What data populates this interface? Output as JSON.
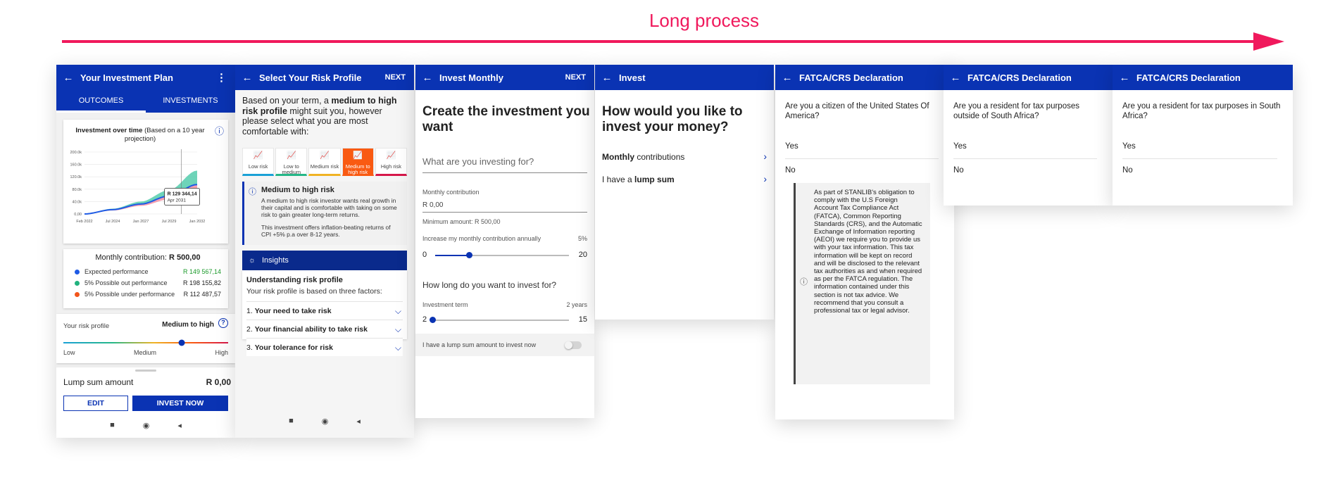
{
  "process": {
    "label": "Long process"
  },
  "screen1": {
    "title": "Your Investment Plan",
    "tabs": [
      "OUTCOMES",
      "INVESTMENTS"
    ],
    "chart_title_bold": "Investment over time",
    "chart_title_rest": "(Based on a 10 year projection)",
    "chart_data": {
      "type": "area",
      "x": [
        "Feb 2022",
        "Jul 2024",
        "Jan 2027",
        "Jul 2029",
        "Jan 2032"
      ],
      "y_ticks": [
        "0,00",
        "40.0k",
        "80.0k",
        "120.0k",
        "160.0k",
        "200.0k"
      ],
      "ylim": [
        0,
        200000
      ],
      "series": [
        {
          "values": [
            0,
            14000,
            32000,
            58000,
            95000
          ]
        },
        {
          "values": [
            0,
            17000,
            40000,
            77000,
            140000
          ]
        },
        {
          "values": [
            0,
            11000,
            26000,
            47000,
            76000
          ]
        }
      ],
      "tooltip_value": "R 129 344,14",
      "tooltip_date": "Apr 2031",
      "tooltip_x": 0.86,
      "colors": [
        "#1e5be5",
        "#3ec5a2",
        "#f48a9d"
      ]
    },
    "monthly_label": "Monthly contribution:",
    "monthly_value": "R 500,00",
    "performance": [
      {
        "label": "Expected performance",
        "value": "R 149 567,14",
        "dot": "#1e5be5",
        "value_color": "#1a9a2a"
      },
      {
        "label": "5% Possible out performance",
        "value": "R 198 155,82",
        "dot": "#21b27e",
        "value_color": "#333333"
      },
      {
        "label": "5% Possible under performance",
        "value": "R 112 487,57",
        "dot": "#f2551b",
        "value_color": "#333333"
      }
    ],
    "risk_label": "Your risk profile",
    "risk_value": "Medium to high",
    "risk_position": 0.73,
    "risk_scale": [
      "Low",
      "Medium",
      "High"
    ],
    "lump_label": "Lump sum amount",
    "lump_value": "R 0,00",
    "edit_btn": "EDIT",
    "invest_btn": "INVEST NOW",
    "nav_icons": [
      "■",
      "◉",
      "◂"
    ]
  },
  "screen2": {
    "title": "Select Your Risk Profile",
    "action": "NEXT",
    "intro_1": "Based on your term, a ",
    "intro_bold": "medium to high risk profile",
    "intro_2": " might suit you, however please select what you are most comfortable with:",
    "tiles": [
      {
        "label": "Low risk",
        "color": "#1aa1d6"
      },
      {
        "label": "Low to medium",
        "color": "#25b787"
      },
      {
        "label": "Medium risk",
        "color": "#f0b324"
      },
      {
        "label": "Medium to high risk",
        "color": "#f95a12"
      },
      {
        "label": "High risk",
        "color": "#d6174a"
      }
    ],
    "info_title": "Medium to high risk",
    "info_p1": "A medium to high risk investor wants real growth in their capital and is comfortable with taking on some risk to gain greater long-term returns.",
    "info_p2": "This investment offers inflation-beating returns of CPI +5% p.a over 8-12 years.",
    "insights": "Insights",
    "understanding": "Understanding risk profile",
    "based_on": "Your risk profile is based on three factors:",
    "factors": [
      {
        "num": "1.",
        "text": "Your need to take risk"
      },
      {
        "num": "2.",
        "text": "Your financial ability to take risk"
      },
      {
        "num": "3.",
        "text": "Your tolerance for risk"
      }
    ],
    "nav_icons": [
      "■",
      "◉",
      "◂"
    ]
  },
  "screen3": {
    "title": "Invest Monthly",
    "action": "NEXT",
    "heading": "Create the investment you want",
    "purpose_placeholder": "What are you investing for?",
    "monthly_label": "Monthly contribution",
    "monthly_value": "R 0,00",
    "minimum": "Minimum amount: R 500,00",
    "increase_label": "Increase my monthly contribution annually",
    "increase_value": "5%",
    "increase_min": "0",
    "increase_max": "20",
    "increase_fraction": 0.25,
    "how_long": "How long do you want to invest for?",
    "term_label": "Investment term",
    "term_value": "2 years",
    "term_min": "2",
    "term_max": "15",
    "term_fraction": 0.0,
    "lump_toggle_label": "I have a lump sum amount to invest now"
  },
  "screen4": {
    "title": "Invest",
    "heading": "How would you like to invest your money?",
    "opt1_bold": "Monthly",
    "opt1_rest": " contributions",
    "opt2_rest": "I have a ",
    "opt2_bold": "lump sum"
  },
  "screen5": {
    "title": "FATCA/CRS Declaration",
    "question": "Are you a citizen of the United States Of America?",
    "yes": "Yes",
    "no": "No",
    "disclaimer": "As part of STANLIB's obligation to comply with the U.S Foreign Account Tax Compliance Act (FATCA), Common Reporting Standards (CRS), and the Automatic Exchange of Information reporting (AEOI) we require you to provide us with your tax information. This tax information will be kept on record and will be disclosed to the relevant tax authorities as and when required as per the FATCA regulation. The information contained under this section is not tax advice. We recommend that you consult a professional tax or legal advisor."
  },
  "screen6": {
    "title": "FATCA/CRS Declaration",
    "question": "Are you a resident for tax purposes outside of South Africa?",
    "yes": "Yes",
    "no": "No"
  },
  "screen7": {
    "title": "FATCA/CRS Declaration",
    "question": "Are you a resident for tax purposes in South Africa?",
    "yes": "Yes",
    "no": "No"
  },
  "icons": {
    "back": "←",
    "kebab": "⋮",
    "info": "ⓘ",
    "bulb": "💡",
    "chevron_down": "⌵",
    "chevron_right": "›"
  }
}
